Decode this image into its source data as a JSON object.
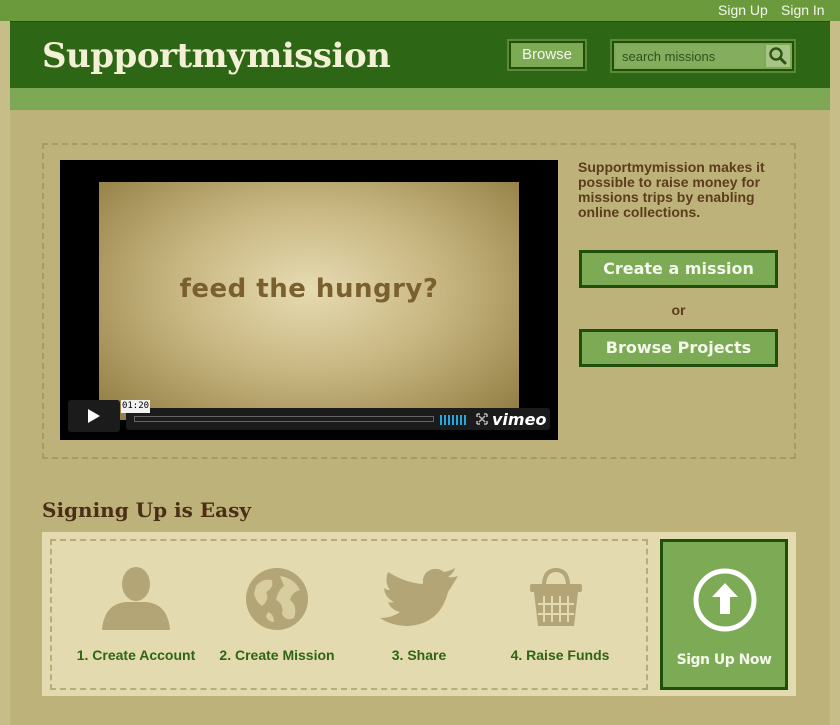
{
  "topbar": {
    "signup": "Sign Up",
    "signin": "Sign In"
  },
  "header": {
    "logo": "Supportmymission",
    "browse_label": "Browse",
    "search_placeholder": "search missions"
  },
  "video": {
    "caption": "feed the hungry?",
    "timestamp": "01:20",
    "brand": "vimeo"
  },
  "feature": {
    "description": "Supportmymission makes it possible to raise money for missions trips by enabling online collections.",
    "create_label": "Create a mission",
    "or_label": "or",
    "browse_projects_label": "Browse Projects"
  },
  "steps": {
    "title": "Signing Up is Easy",
    "items": [
      {
        "label": "1. Create Account",
        "icon": "person-icon"
      },
      {
        "label": "2. Create Mission",
        "icon": "globe-icon"
      },
      {
        "label": "3. Share",
        "icon": "bird-icon"
      },
      {
        "label": "4. Raise Funds",
        "icon": "basket-icon"
      }
    ],
    "signup_label": "Sign Up Now"
  },
  "colors": {
    "header_green": "#2d6614",
    "button_green": "#7daa55",
    "background_tan": "#c6bd88",
    "text_brown": "#5b3c1c",
    "step_green": "#2f6414",
    "icon_tan": "#b3a575"
  }
}
